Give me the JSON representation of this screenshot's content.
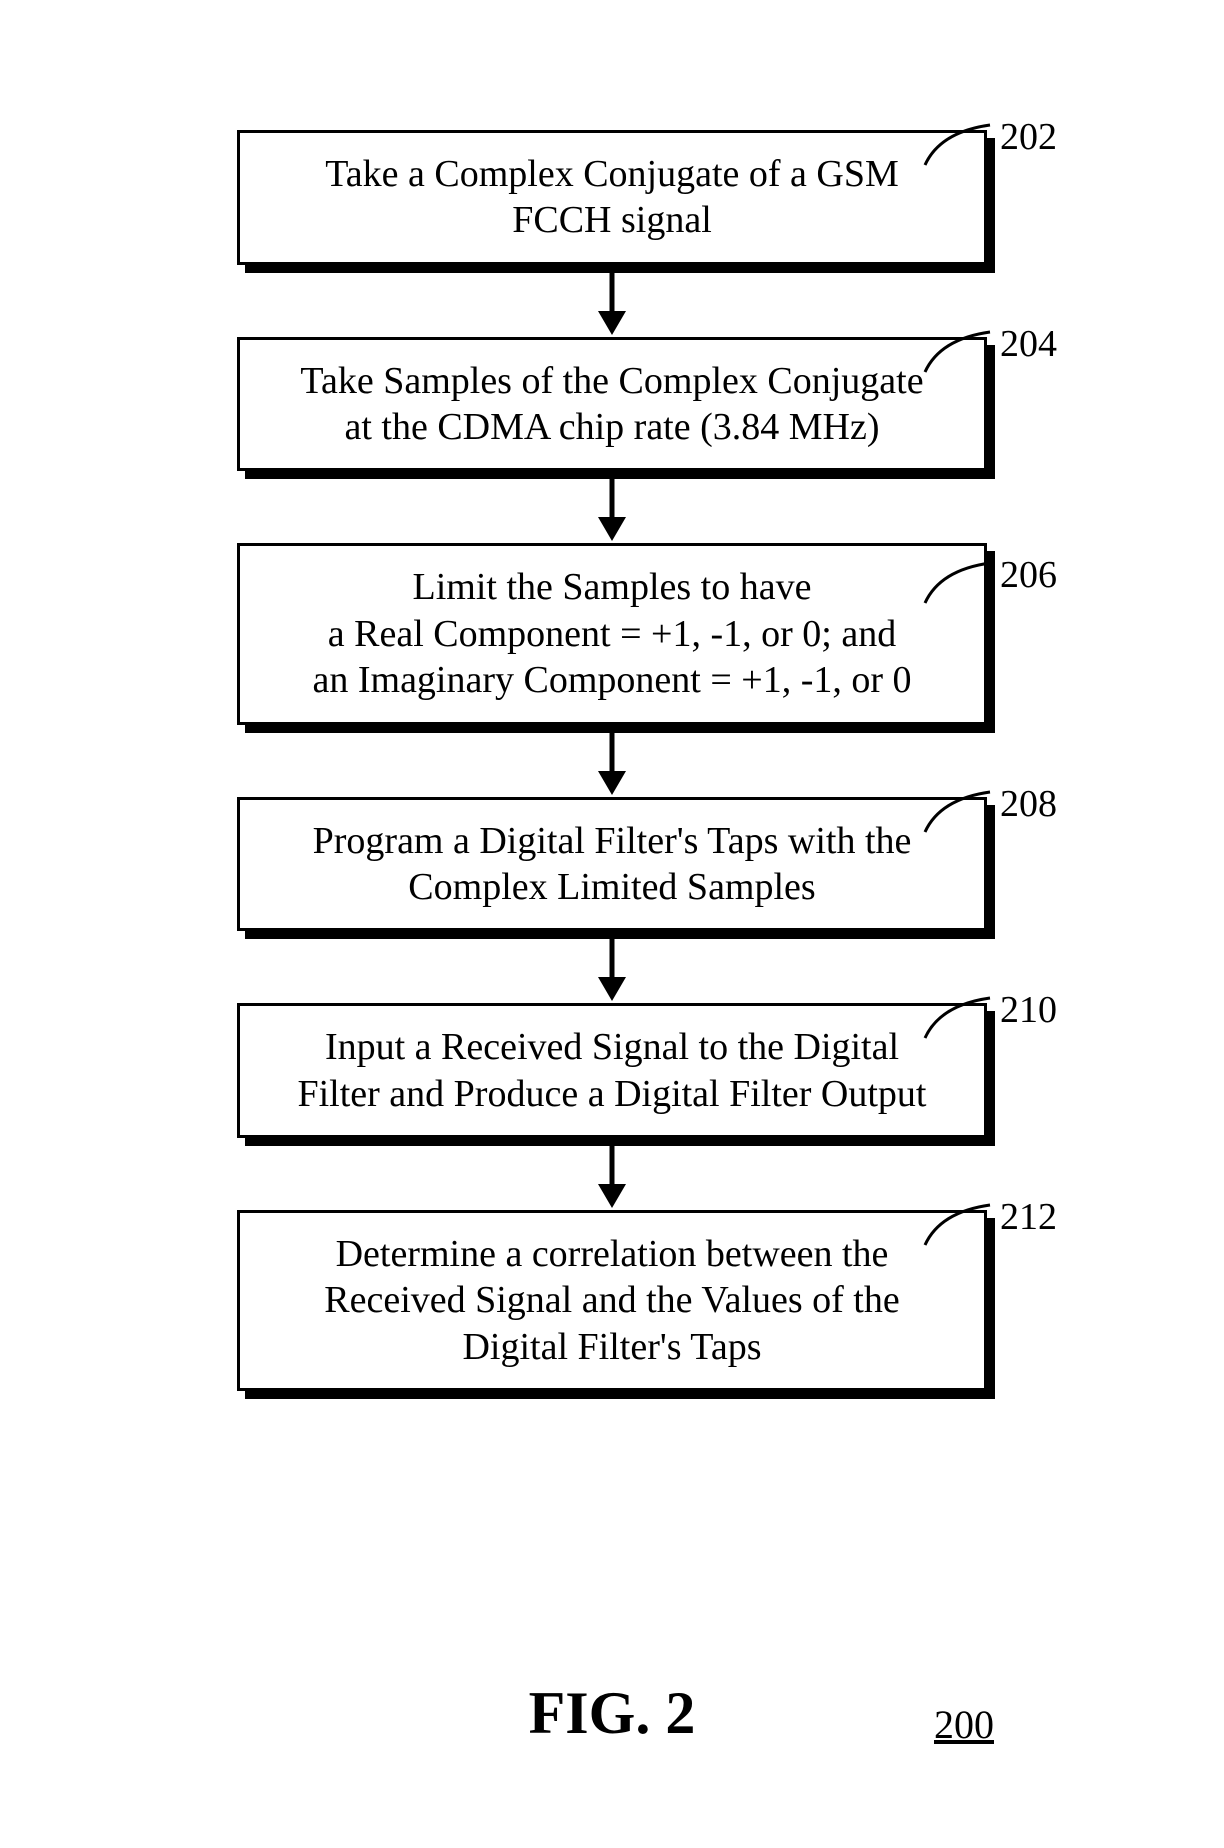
{
  "steps": [
    {
      "ref": "202",
      "lines": [
        "Take a Complex Conjugate of a GSM",
        "FCCH signal"
      ]
    },
    {
      "ref": "204",
      "lines": [
        "Take Samples of the Complex Conjugate",
        "at the CDMA chip rate (3.84 MHz)"
      ]
    },
    {
      "ref": "206",
      "lines": [
        "Limit the Samples to have",
        "a Real Component = +1, -1, or 0; and",
        "an Imaginary Component = +1, -1, or 0"
      ]
    },
    {
      "ref": "208",
      "lines": [
        "Program a Digital Filter's Taps with the",
        "Complex Limited Samples"
      ]
    },
    {
      "ref": "210",
      "lines": [
        "Input a Received Signal to the Digital",
        "Filter and Produce a Digital Filter Output"
      ]
    },
    {
      "ref": "212",
      "lines": [
        "Determine a correlation between the",
        "Received Signal and the Values of the",
        "Digital Filter's Taps"
      ]
    }
  ],
  "figure_label": "FIG. 2",
  "figure_number": "200"
}
